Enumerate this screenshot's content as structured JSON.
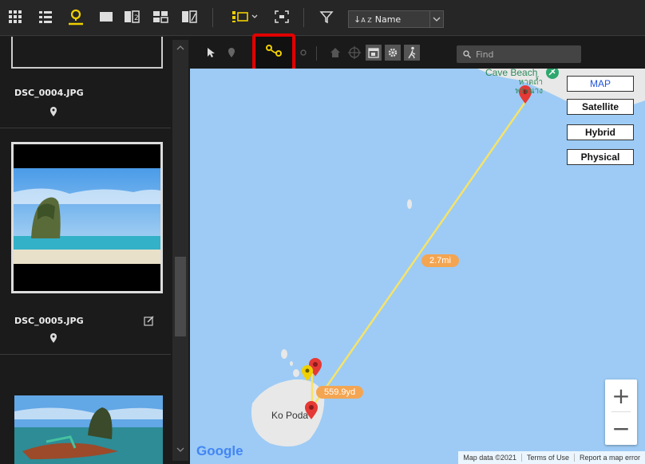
{
  "toolbar": {
    "sort_label": "Name",
    "icons": [
      "grid-view-icon",
      "list-view-icon",
      "map-view-icon",
      "single-view-icon",
      "compare-view-icon",
      "multi-view-icon",
      "edit-view-icon",
      "display-options-icon",
      "fit-icon",
      "filter-icon",
      "sort-icon"
    ],
    "accent": "#f0d000"
  },
  "left_panel": {
    "items": [
      {
        "filename": "DSC_0004.JPG",
        "location": true,
        "edited": false
      },
      {
        "filename": "DSC_0005.JPG",
        "location": true,
        "edited": true
      },
      {
        "filename": "",
        "location": false,
        "edited": false
      }
    ]
  },
  "map_toolbar": {
    "find_placeholder": "Find",
    "highlight_color": "#e00000",
    "icons": [
      "select-icon",
      "place-pin-icon",
      "track-icon",
      "route-icon",
      "home-icon",
      "target-icon",
      "calendar-icon",
      "settings-icon",
      "walk-icon"
    ]
  },
  "map": {
    "place_top": "Cave Beach",
    "place_top_thai": "หาดถ้ำพระนาง",
    "place_island": "Ko Poda",
    "distance_long": "2.7mi",
    "distance_short": "559.9yd",
    "map_types": [
      "MAP",
      "Satellite",
      "Hybrid",
      "Physical"
    ],
    "selected_map_type": "MAP",
    "zoom_in": "+",
    "zoom_out": "−",
    "logo": "Google",
    "footer": {
      "map_data": "Map data ©2021",
      "terms": "Terms of Use",
      "report": "Report a map error"
    },
    "colors": {
      "water": "#9dcbf5",
      "land": "#e8e8e8",
      "track": "#f5e36a",
      "pin": "#e53935"
    }
  }
}
